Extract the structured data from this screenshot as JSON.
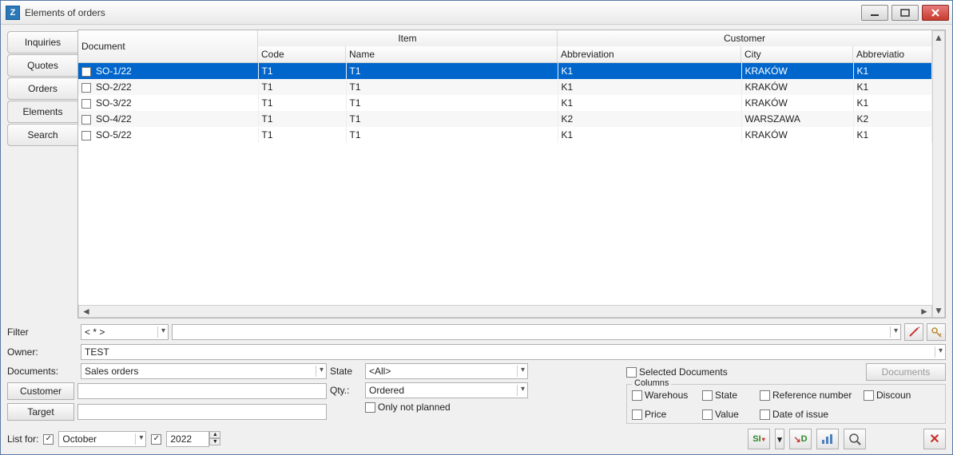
{
  "window": {
    "app_icon_letter": "Z",
    "title": "Elements of orders"
  },
  "side_tabs": [
    {
      "label": "Inquiries",
      "active": false
    },
    {
      "label": "Quotes",
      "active": false
    },
    {
      "label": "Orders",
      "active": false
    },
    {
      "label": "Elements",
      "active": true
    },
    {
      "label": "Search",
      "active": false
    }
  ],
  "grid": {
    "headers": {
      "document": "Document",
      "item_group": "Item",
      "item_code": "Code",
      "item_name": "Name",
      "customer_group": "Customer",
      "cust_abbrev": "Abbreviation",
      "cust_city": "City",
      "cust_abbrev2": "Abbreviatio"
    },
    "rows": [
      {
        "doc": "SO-1/22",
        "code": "T1",
        "name": "T1",
        "abbr": "K1",
        "city": "KRAKÓW",
        "abbr2": "K1",
        "selected": true
      },
      {
        "doc": "SO-2/22",
        "code": "T1",
        "name": "T1",
        "abbr": "K1",
        "city": "KRAKÓW",
        "abbr2": "K1",
        "selected": false
      },
      {
        "doc": "SO-3/22",
        "code": "T1",
        "name": "T1",
        "abbr": "K1",
        "city": "KRAKÓW",
        "abbr2": "K1",
        "selected": false
      },
      {
        "doc": "SO-4/22",
        "code": "T1",
        "name": "T1",
        "abbr": "K2",
        "city": "WARSZAWA",
        "abbr2": "K2",
        "selected": false
      },
      {
        "doc": "SO-5/22",
        "code": "T1",
        "name": "T1",
        "abbr": "K1",
        "city": "KRAKÓW",
        "abbr2": "K1",
        "selected": false
      }
    ]
  },
  "filters": {
    "filter_label": "Filter",
    "filter_op": "< * >",
    "owner_label": "Owner:",
    "owner_value": "TEST",
    "documents_label": "Documents:",
    "documents_value": "Sales orders",
    "state_label": "State",
    "state_value": "<All>",
    "qty_label": "Qty.:",
    "qty_value": "Ordered",
    "only_not_planned": "Only not planned",
    "customer_button": "Customer",
    "target_button": "Target",
    "selected_documents": "Selected Documents",
    "documents_button": "Documents",
    "columns_legend": "Columns",
    "col_warehouse": "Warehous",
    "col_state": "State",
    "col_refnum": "Reference number",
    "col_discount": "Discoun",
    "col_price": "Price",
    "col_value": "Value",
    "col_date": "Date of issue"
  },
  "listfor": {
    "label": "List for:",
    "month": "October",
    "year": "2022"
  },
  "toolbar": {
    "si": "SI",
    "d": "D"
  }
}
